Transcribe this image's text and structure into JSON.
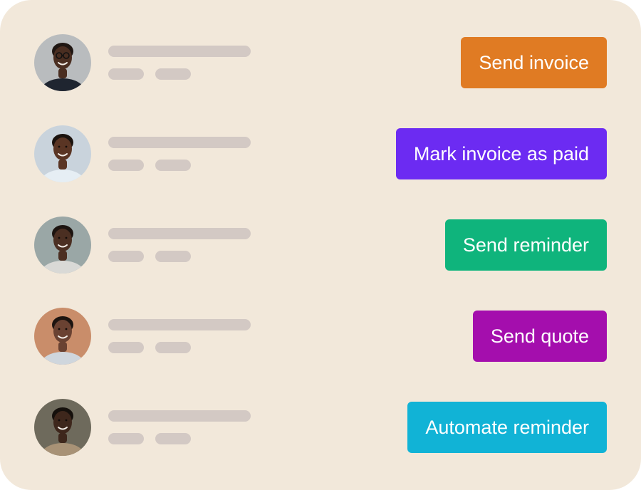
{
  "contacts": [
    {
      "action_label": "Send invoice",
      "button_color": "#e07b23",
      "avatar": {
        "bg": "#b9bcbe",
        "skin": "#4a2e21",
        "hair": "#1f1612",
        "shirt": "#1f2530",
        "glasses": true
      }
    },
    {
      "action_label": "Mark invoice as paid",
      "button_color": "#6c2bf2",
      "avatar": {
        "bg": "#c9d3dc",
        "skin": "#5a3524",
        "hair": "#1a120e",
        "shirt": "#e6eef4",
        "glasses": false
      }
    },
    {
      "action_label": "Send reminder",
      "button_color": "#0fb47c",
      "avatar": {
        "bg": "#9aa7a6",
        "skin": "#4b2f22",
        "hair": "#1c1410",
        "shirt": "#d9d9d6",
        "glasses": false
      }
    },
    {
      "action_label": "Send quote",
      "button_color": "#a40ead",
      "avatar": {
        "bg": "#c98d6a",
        "skin": "#6a4232",
        "hair": "#1d1410",
        "shirt": "#cfd6dd",
        "glasses": false
      }
    },
    {
      "action_label": "Automate reminder",
      "button_color": "#11b3d6",
      "avatar": {
        "bg": "#6e6a5c",
        "skin": "#3e271c",
        "hair": "#15100c",
        "shirt": "#a89276",
        "glasses": false
      }
    }
  ]
}
